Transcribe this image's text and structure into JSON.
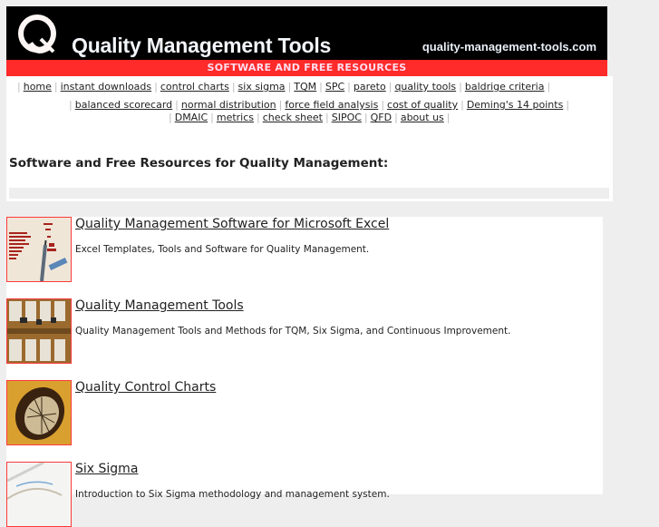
{
  "header": {
    "logo_letter": "Q",
    "site_title": "Quality Management Tools",
    "domain": "quality-management-tools.com",
    "banner": "SOFTWARE AND FREE RESOURCES"
  },
  "nav": {
    "row1": [
      "home",
      "instant downloads",
      "control charts",
      "six sigma",
      "TQM",
      "SPC",
      "pareto",
      "quality tools",
      "baldrige criteria"
    ],
    "row2": [
      "balanced scorecard",
      "normal distribution",
      "force field analysis",
      "cost of quality",
      "Deming's 14 points"
    ],
    "row3": [
      "DMAIC",
      "metrics",
      "check sheet",
      "SIPOC",
      "QFD",
      "about us"
    ]
  },
  "intro": {
    "heading": "Software and Free Resources for Quality Management:"
  },
  "items": [
    {
      "title": "Quality Management Software for Microsoft Excel",
      "description": "Excel Templates, Tools and Software for Quality Management.",
      "thumb": "chart-thumbnail"
    },
    {
      "title": "Quality Management Tools",
      "description": "Quality Management Tools and Methods for TQM, Six Sigma, and Continuous Improvement.",
      "thumb": "drawers-thumbnail"
    },
    {
      "title": "Quality Control Charts",
      "description": "",
      "thumb": "compass-thumbnail"
    },
    {
      "title": "Six Sigma",
      "description": "Introduction to Six Sigma methodology and management system.",
      "thumb": "graph-thumbnail"
    }
  ],
  "colors": {
    "header_bg": "#000000",
    "banner_bg": "#ff2a2a",
    "page_bg": "#eeeeee",
    "thumb_border": "#ff3a3a"
  }
}
